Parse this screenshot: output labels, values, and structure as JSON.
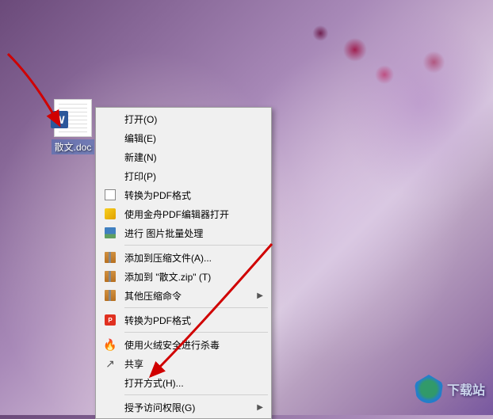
{
  "desktop": {
    "file_icon": {
      "badge": "W",
      "label": "散文.doc"
    }
  },
  "context_menu": {
    "items": [
      {
        "icon": "",
        "label": "打开(O)",
        "has_submenu": false
      },
      {
        "icon": "",
        "label": "编辑(E)",
        "has_submenu": false
      },
      {
        "icon": "",
        "label": "新建(N)",
        "has_submenu": false
      },
      {
        "icon": "",
        "label": "打印(P)",
        "has_submenu": false
      },
      {
        "icon": "pdf",
        "label": "转换为PDF格式",
        "has_submenu": false
      },
      {
        "icon": "gold",
        "label": "使用金舟PDF编辑器打开",
        "has_submenu": false
      },
      {
        "icon": "img",
        "label": "进行 图片批量处理",
        "has_submenu": false
      },
      {
        "sep": true
      },
      {
        "icon": "zip",
        "label": "添加到压缩文件(A)...",
        "has_submenu": false
      },
      {
        "icon": "zip",
        "label": "添加到 \"散文.zip\" (T)",
        "has_submenu": false
      },
      {
        "icon": "zip",
        "label": "其他压缩命令",
        "has_submenu": true
      },
      {
        "sep": true
      },
      {
        "icon": "pdfapp",
        "label": "转换为PDF格式",
        "has_submenu": false
      },
      {
        "sep": true
      },
      {
        "icon": "huorong",
        "label": "使用火绒安全进行杀毒",
        "has_submenu": false
      },
      {
        "icon": "share",
        "label": "共享",
        "has_submenu": false
      },
      {
        "icon": "",
        "label": "打开方式(H)...",
        "has_submenu": false
      },
      {
        "sep": true
      },
      {
        "icon": "",
        "label": "授予访问权限(G)",
        "has_submenu": true
      }
    ]
  },
  "watermark": {
    "text": "下载站",
    "url": "www"
  },
  "icon_names": {
    "pdf": "document-icon",
    "gold": "gold-pdf-icon",
    "img": "image-batch-icon",
    "zip": "archive-icon",
    "pdfapp": "pdf-app-icon",
    "huorong": "huorong-icon",
    "share": "share-icon"
  }
}
